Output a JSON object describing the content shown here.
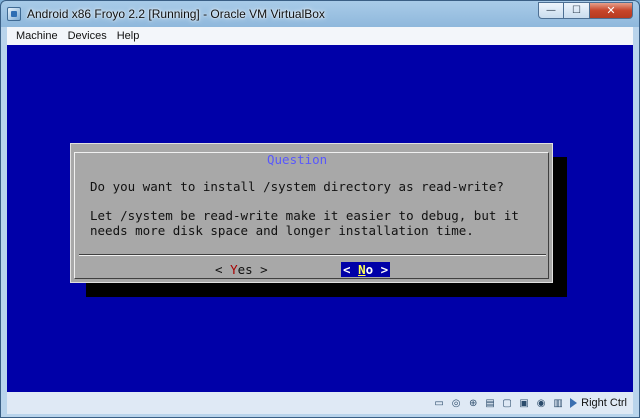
{
  "window": {
    "title": "Android x86 Froyo 2.2 [Running] - Oracle VM VirtualBox",
    "controls": {
      "minimize": "—",
      "maximize": "☐",
      "close": "✕"
    }
  },
  "menubar": {
    "items": [
      "Machine",
      "Devices",
      "Help"
    ]
  },
  "dialog": {
    "title": "Question",
    "question": "Do you want to install /system directory as read-write?",
    "description_line1": "Let /system be read-write make it easier to debug, but it",
    "description_line2": "needs more disk space and longer installation time.",
    "buttons": {
      "yes": {
        "left": "< ",
        "hot": "Y",
        "rest": "es",
        "right": " >"
      },
      "no": {
        "left": "< ",
        "hot": "N",
        "rest": "o",
        "right": " >"
      },
      "selected": "no"
    },
    "colors": {
      "background": "#0000a8",
      "dialog": "#a8a8a8",
      "title": "#5858fc",
      "hotkey_yes": "#a80000",
      "hotkey_no": "#ffff54"
    }
  },
  "statusbar": {
    "icons": [
      "hard-disk-icon",
      "optical-drive-icon",
      "usb-icon",
      "shared-folders-icon",
      "display-icon",
      "video-capture-icon",
      "network-icon",
      "mouse-integration-icon"
    ],
    "host_key_label": "Right Ctrl"
  }
}
